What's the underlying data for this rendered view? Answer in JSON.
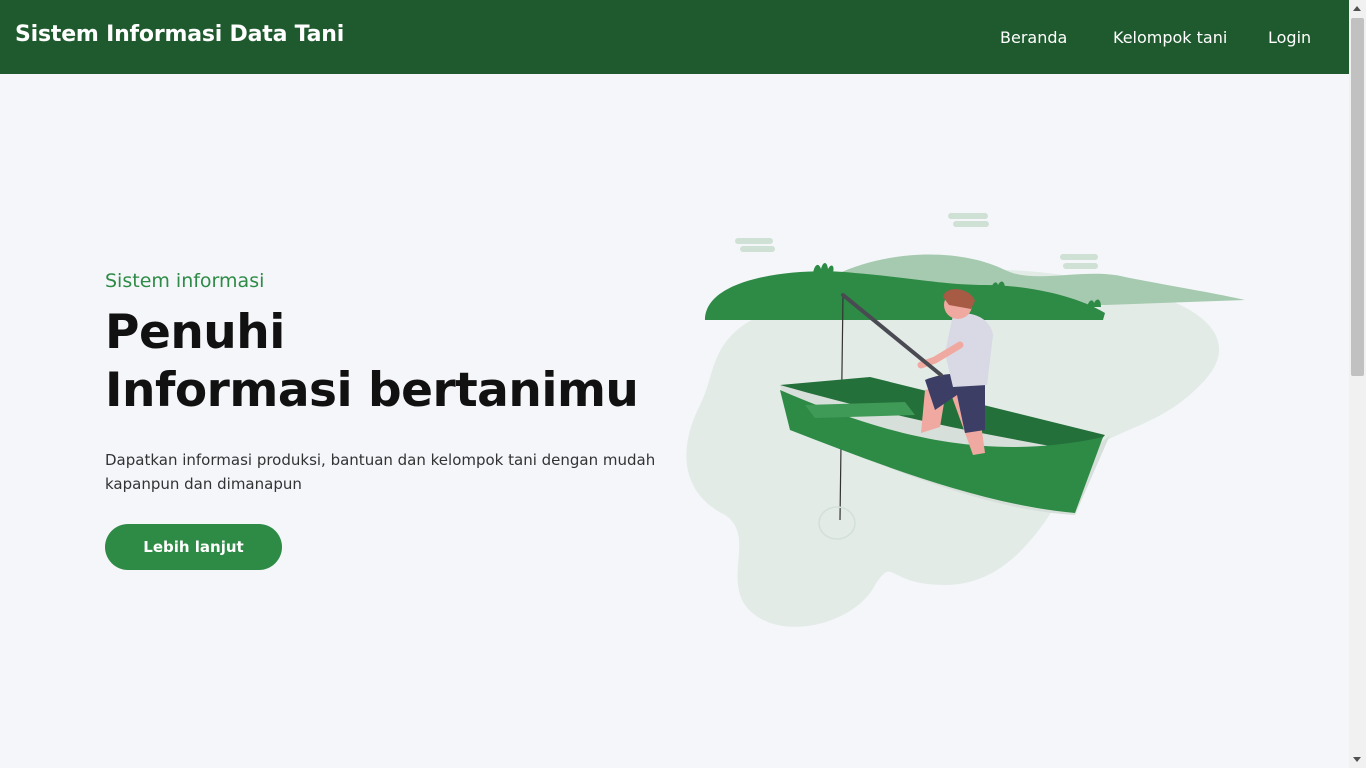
{
  "navbar": {
    "brand": "Sistem Informasi Data Tani",
    "links": [
      "Beranda",
      "Kelompok tani",
      "Login"
    ]
  },
  "hero": {
    "subtitle": "Sistem informasi",
    "title_line1": "Penuhi",
    "title_line2": "Informasi bertanimu",
    "description": "Dapatkan informasi produksi, bantuan dan kelompok tani dengan mudah kapanpun dan dimanapun",
    "cta_label": "Lebih lanjut"
  },
  "illustration": {
    "name": "man-fishing-in-boat-illustration"
  },
  "colors": {
    "navbar": "#1f5a2e",
    "accent": "#2e8b46",
    "background": "#f4f6fa"
  }
}
